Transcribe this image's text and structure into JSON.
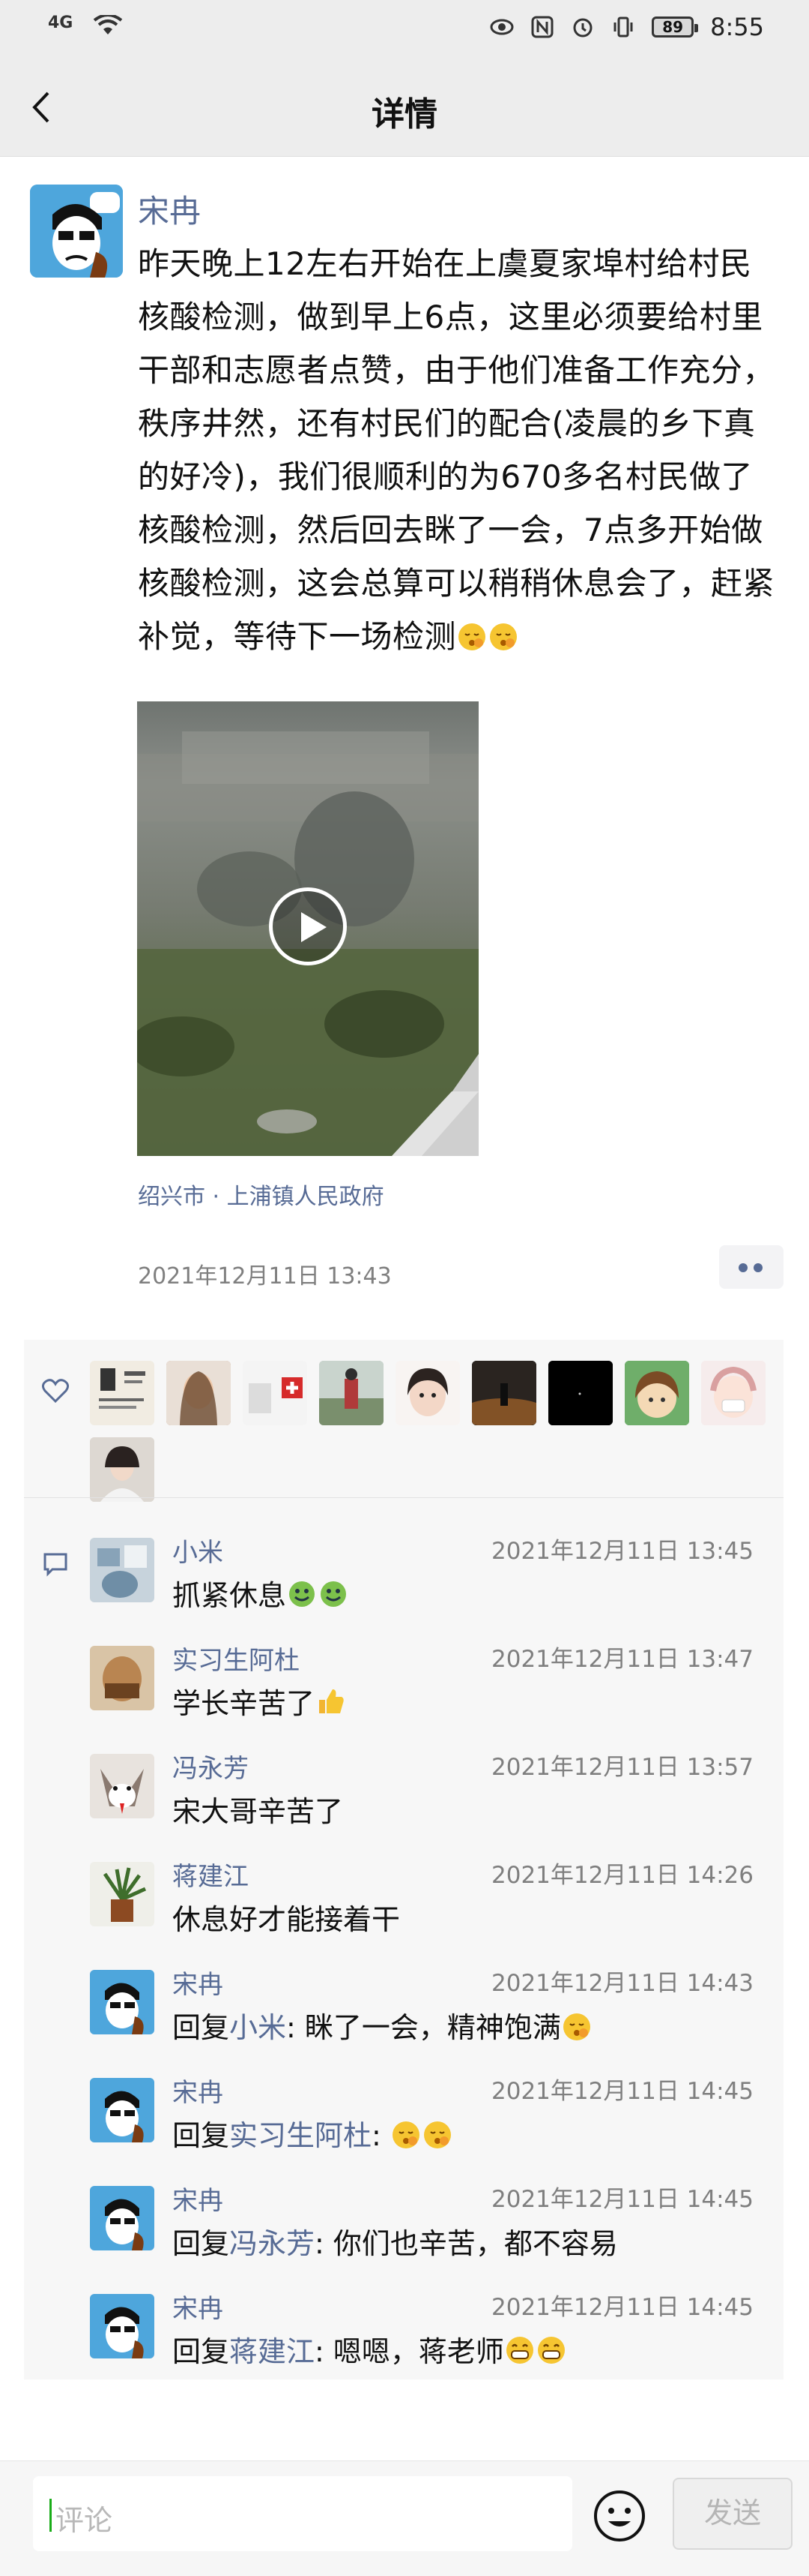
{
  "status_bar": {
    "signal": "4G",
    "battery": "89",
    "time": "8:55"
  },
  "nav": {
    "title": "详情"
  },
  "post": {
    "author": "宋冉",
    "text": "昨天晚上12左右开始在上虞夏家埠村给村民核酸检测，做到早上6点，这里必须要给村里干部和志愿者点赞，由于他们准备工作充分，秩序井然，还有村民们的配合(凌晨的乡下真的好冷)，我们很顺利的为670多名村民做了核酸检测，然后回去眯了一会，7点多开始做核酸检测，这会总算可以稍稍休息会了，赶紧补觉，等待下一场检测",
    "location": "绍兴市 · 上浦镇人民政府",
    "time": "2021年12月11日 13:43"
  },
  "comments": [
    {
      "name": "小米",
      "time": "2021年12月11日 13:45",
      "text": "抓紧休息"
    },
    {
      "name": "实习生阿杜",
      "time": "2021年12月11日 13:47",
      "text": "学长辛苦了"
    },
    {
      "name": "冯永芳",
      "time": "2021年12月11日 13:57",
      "text": "宋大哥辛苦了"
    },
    {
      "name": "蒋建江",
      "time": "2021年12月11日 14:26",
      "text": "休息好才能接着干"
    },
    {
      "name": "宋冉",
      "time": "2021年12月11日 14:43",
      "reply_prefix": "回复",
      "reply_to": "小米",
      "text": ": 眯了一会，精神饱满"
    },
    {
      "name": "宋冉",
      "time": "2021年12月11日 14:45",
      "reply_prefix": "回复",
      "reply_to": "实习生阿杜",
      "text": ": "
    },
    {
      "name": "宋冉",
      "time": "2021年12月11日 14:45",
      "reply_prefix": "回复",
      "reply_to": "冯永芳",
      "text": ": 你们也辛苦，都不容易"
    },
    {
      "name": "宋冉",
      "time": "2021年12月11日 14:45",
      "reply_prefix": "回复",
      "reply_to": "蒋建江",
      "text": ": 嗯嗯，蒋老师"
    }
  ],
  "input": {
    "placeholder": "评论",
    "send_label": "发送"
  }
}
